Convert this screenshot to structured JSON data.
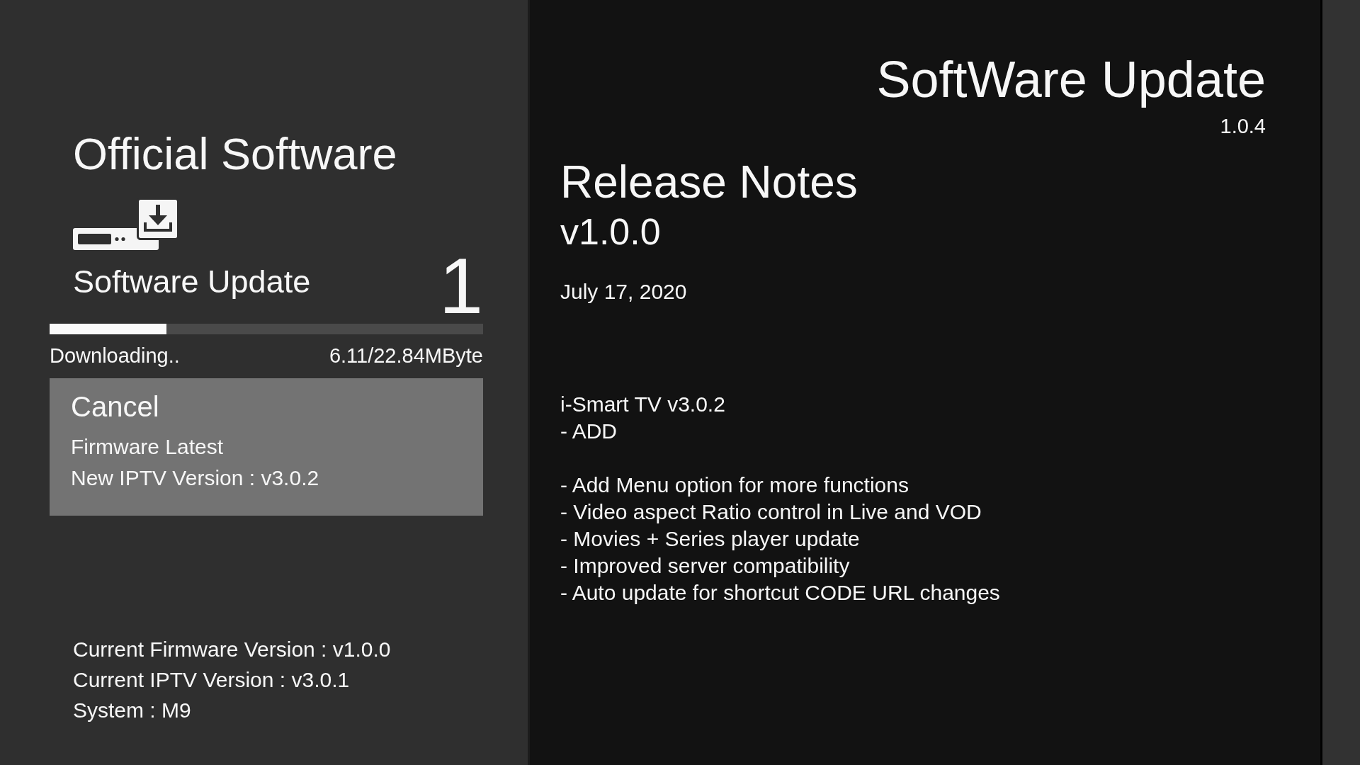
{
  "update_panel": {
    "title": "Official Software",
    "subtitle": "Software Update",
    "count": "1",
    "progress": {
      "level": 0.27,
      "status": "Downloading..",
      "size": "6.11/22.84MByte"
    },
    "option": {
      "label": "Cancel",
      "focused": true,
      "lines": [
        "Firmware Latest",
        "New IPTV Version : v3.0.2"
      ]
    },
    "system_info": [
      "Current Firmware Version : v1.0.0",
      "Current IPTV Version : v3.0.1",
      "System : M9"
    ]
  },
  "header": {
    "title": "SoftWare Update",
    "version": "1.0.4"
  },
  "release_notes": {
    "title": "Release Notes",
    "version": "v1.0.0",
    "date": "July 17, 2020",
    "product": "i-Smart TV v3.0.2",
    "section": "- ADD",
    "changes": [
      "- Add Menu option for more functions",
      "- Video aspect Ratio control in Live and VOD",
      "- Movies + Series player update",
      "- Improved server compatibility",
      "- Auto update for shortcut CODE URL changes"
    ]
  }
}
